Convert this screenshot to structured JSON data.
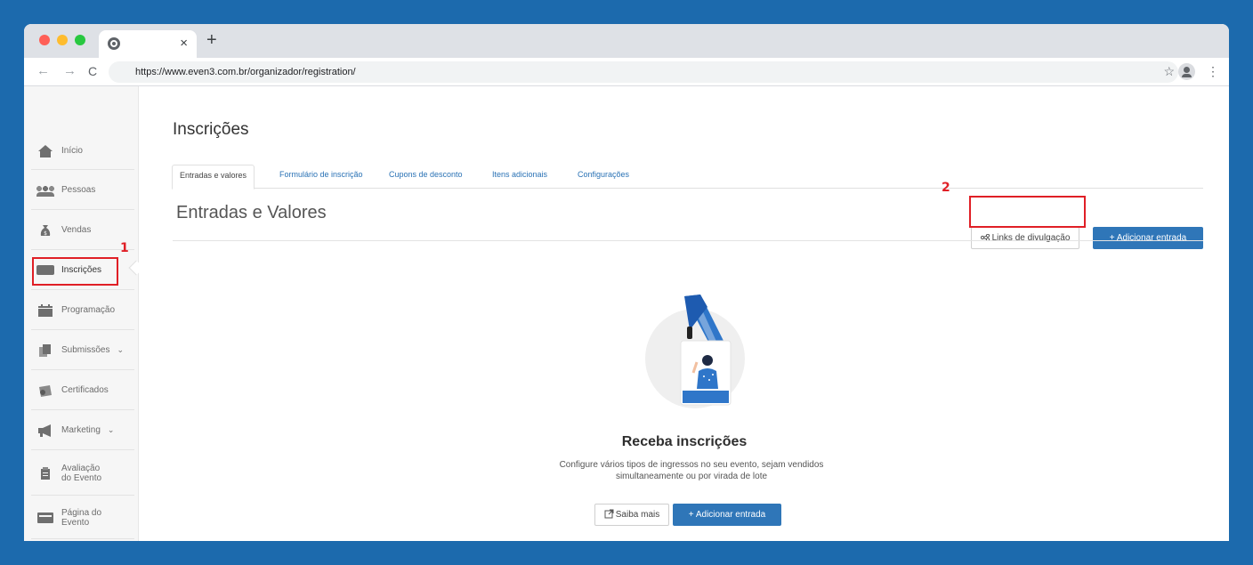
{
  "browser": {
    "tab_close": "×",
    "new_tab": "+",
    "back": "←",
    "forward": "→",
    "reload": "C",
    "url": "https://www.even3.com.br/organizador/registration/",
    "star": "☆",
    "menu": "⋮"
  },
  "sidebar": {
    "items": [
      {
        "label": "Início",
        "icon": "home-icon"
      },
      {
        "label": "Pessoas",
        "icon": "people-icon"
      },
      {
        "label": "Vendas",
        "icon": "money-bag-icon"
      },
      {
        "label": "Inscrições",
        "icon": "ticket-icon",
        "active": true
      },
      {
        "label": "Programação",
        "icon": "calendar-icon"
      },
      {
        "label": "Submissões",
        "icon": "documents-icon",
        "chevron": "⌄"
      },
      {
        "label": "Certificados",
        "icon": "certificate-icon"
      },
      {
        "label": "Marketing",
        "icon": "megaphone-icon",
        "chevron": "⌄"
      },
      {
        "label_line1": "Avaliação",
        "label_line2": "do Evento",
        "icon": "clipboard-icon"
      },
      {
        "label_line1": "Página do",
        "label_line2": "Evento",
        "icon": "webpage-icon"
      }
    ]
  },
  "annotations": {
    "marker1": "1",
    "marker2": "2",
    "color": "#e01f26"
  },
  "main": {
    "title": "Inscrições",
    "tabs": [
      {
        "label": "Entradas e valores",
        "active": true
      },
      {
        "label": "Formulário de inscrição"
      },
      {
        "label": "Cupons de desconto"
      },
      {
        "label": "Itens adicionais"
      },
      {
        "label": "Configurações"
      }
    ],
    "section_title": "Entradas e Valores",
    "links_button": "Links de divulgação",
    "add_button": "+ Adicionar entrada",
    "empty": {
      "title": "Receba inscrições",
      "desc_line1": "Configure vários tipos de ingressos no seu evento, sejam vendidos",
      "desc_line2": "simultaneamente ou por virada de lote",
      "learn_more": "Saiba mais",
      "add_button": "+ Adicionar entrada"
    }
  },
  "colors": {
    "background": "#1c6aad",
    "primary": "#2f76b8",
    "link": "#2a72b5"
  }
}
